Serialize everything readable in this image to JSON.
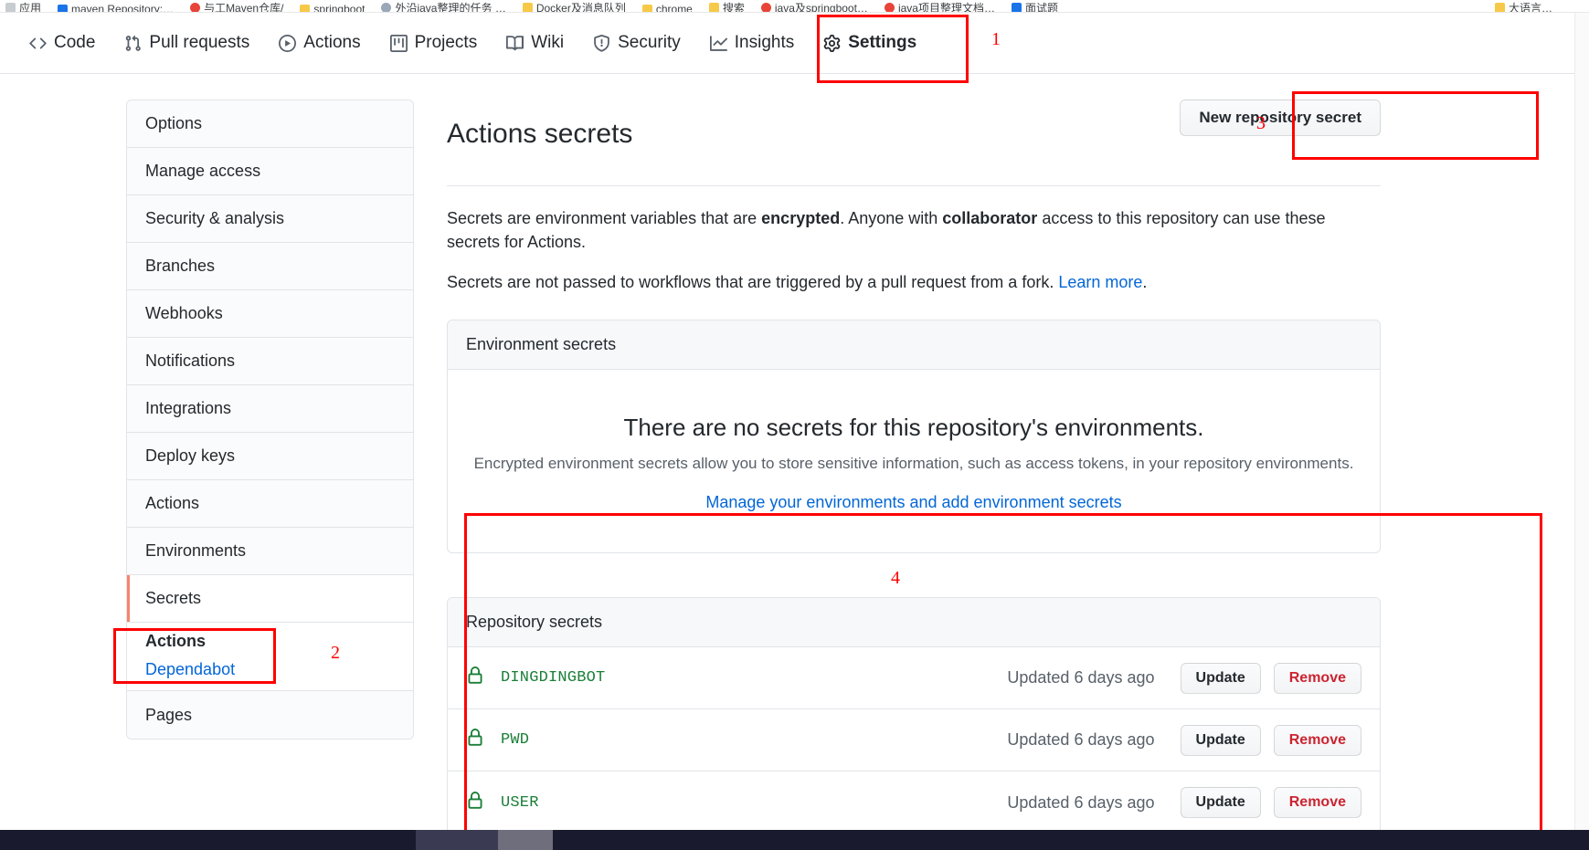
{
  "browser": {
    "bookmarks": [
      {
        "label": "应用",
        "icon": "grey-icon"
      },
      {
        "label": "maven Repository:…",
        "icon": "blue-icon"
      },
      {
        "label": "与工Maven仓库/",
        "icon": "red-icon"
      },
      {
        "label": "springboot",
        "icon": "folder-icon"
      },
      {
        "label": "外沿java整理的任务 …",
        "icon": "globe-icon"
      },
      {
        "label": "Docker及消息队列",
        "icon": "folder-icon"
      },
      {
        "label": "chrome",
        "icon": "folder-icon"
      },
      {
        "label": "搜索",
        "icon": "folder-icon"
      },
      {
        "label": "java及springboot…",
        "icon": "red-icon"
      },
      {
        "label": "java项目整理文档…",
        "icon": "red-icon"
      },
      {
        "label": "面试题",
        "icon": "blue-icon"
      },
      {
        "label": "大语言…",
        "icon": "folder-icon"
      }
    ]
  },
  "repo_nav": {
    "items": [
      {
        "label": "Code",
        "icon": "code-icon",
        "selected": false
      },
      {
        "label": "Pull requests",
        "icon": "git-pull-request-icon",
        "selected": false
      },
      {
        "label": "Actions",
        "icon": "play-circle-icon",
        "selected": false
      },
      {
        "label": "Projects",
        "icon": "project-board-icon",
        "selected": false
      },
      {
        "label": "Wiki",
        "icon": "book-icon",
        "selected": false
      },
      {
        "label": "Security",
        "icon": "shield-icon",
        "selected": false
      },
      {
        "label": "Insights",
        "icon": "graph-icon",
        "selected": false
      },
      {
        "label": "Settings",
        "icon": "gear-icon",
        "selected": true
      }
    ]
  },
  "sidebar": {
    "items": [
      {
        "label": "Options",
        "active": false
      },
      {
        "label": "Manage access",
        "active": false
      },
      {
        "label": "Security & analysis",
        "active": false
      },
      {
        "label": "Branches",
        "active": false
      },
      {
        "label": "Webhooks",
        "active": false
      },
      {
        "label": "Notifications",
        "active": false
      },
      {
        "label": "Integrations",
        "active": false
      },
      {
        "label": "Deploy keys",
        "active": false
      },
      {
        "label": "Actions",
        "active": false
      },
      {
        "label": "Environments",
        "active": false
      },
      {
        "label": "Secrets",
        "active": true
      }
    ],
    "secrets_sub": {
      "heading": "Actions",
      "link": "Dependabot"
    },
    "after_items": [
      {
        "label": "Pages",
        "active": false
      }
    ]
  },
  "main": {
    "title": "Actions secrets",
    "new_secret_button": "New repository secret",
    "desc_line1_pre": "Secrets are environment variables that are ",
    "desc_line1_bold1": "encrypted",
    "desc_line1_mid": ". Anyone with ",
    "desc_line1_bold2": "collaborator",
    "desc_line1_post": " access to this repository can use these secrets for Actions.",
    "desc_line2_pre": "Secrets are not passed to workflows that are triggered by a pull request from a fork. ",
    "desc_line2_link": "Learn more",
    "desc_line2_post": ".",
    "environment_secrets": {
      "header": "Environment secrets",
      "empty_title": "There are no secrets for this repository's environments.",
      "empty_subtitle": "Encrypted environment secrets allow you to store sensitive information, such as access tokens, in your repository environments.",
      "empty_link": "Manage your environments and add environment secrets"
    },
    "repository_secrets": {
      "header": "Repository secrets",
      "update_label": "Update",
      "remove_label": "Remove",
      "rows": [
        {
          "name": "DINGDINGBOT",
          "updated": "Updated 6 days ago",
          "icon": "lock-icon"
        },
        {
          "name": "PWD",
          "updated": "Updated 6 days ago",
          "icon": "lock-icon"
        },
        {
          "name": "USER",
          "updated": "Updated 6 days ago",
          "icon": "lock-icon"
        }
      ]
    }
  },
  "annotations": [
    {
      "number": "1",
      "target": "settings-tab"
    },
    {
      "number": "2",
      "target": "sidebar-secrets"
    },
    {
      "number": "3",
      "target": "new-repository-secret-button"
    },
    {
      "number": "4",
      "target": "repository-secrets-panel"
    }
  ],
  "colors": {
    "accent_link": "#0366d6",
    "annotation_red": "#ff0000",
    "secret_name_green": "#1a7f37",
    "danger_red": "#cb2431",
    "active_bar_orange": "#f9826c"
  }
}
